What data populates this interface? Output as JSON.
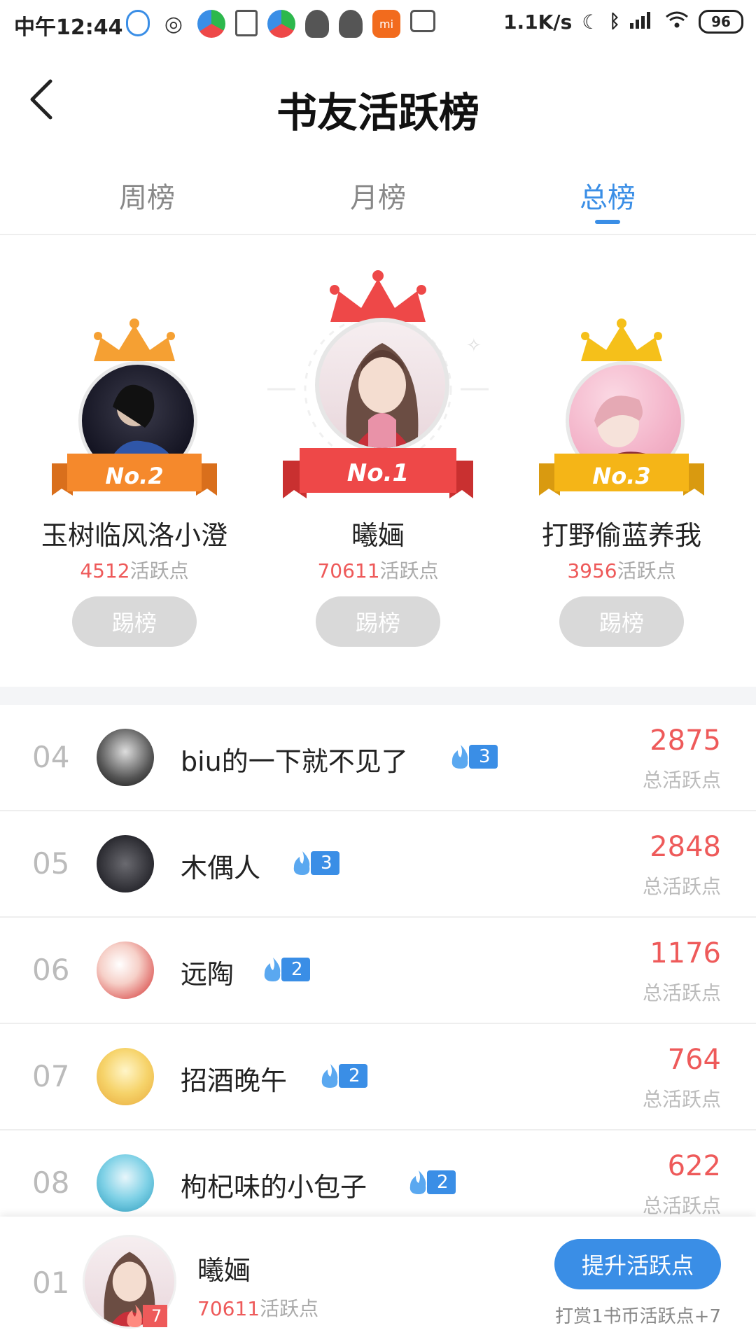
{
  "status_bar": {
    "time": "中午12:44",
    "network_speed": "1.1K/s",
    "battery": "96",
    "app_icons": [
      "qq-icon",
      "weibo-icon",
      "browser-icon",
      "doc-icon",
      "browser-icon",
      "qq-icon",
      "qq-icon",
      "mi-icon",
      "tv-icon"
    ]
  },
  "header": {
    "title": "书友活跃榜"
  },
  "tabs": [
    {
      "label": "周榜",
      "active": false
    },
    {
      "label": "月榜",
      "active": false
    },
    {
      "label": "总榜",
      "active": true
    }
  ],
  "podium": [
    {
      "rank_label": "No.2",
      "name": "玉树临风洛小澄",
      "score": "4512",
      "unit": "活跃点",
      "button": "踢榜",
      "crown_color": "#f5a033",
      "ribbon_color": "#f5892c"
    },
    {
      "rank_label": "No.1",
      "name": "曦婳",
      "score": "70611",
      "unit": "活跃点",
      "button": "踢榜",
      "crown_color": "#ee4848",
      "ribbon_color": "#ee4848"
    },
    {
      "rank_label": "No.3",
      "name": "打野偷蓝养我",
      "score": "3956",
      "unit": "活跃点",
      "button": "踢榜",
      "crown_color": "#f5c01a",
      "ribbon_color": "#f5b517"
    }
  ],
  "list": [
    {
      "rank": "04",
      "name": "biu的一下就不见了",
      "level": "3",
      "score": "2875",
      "score_label": "总活跃点"
    },
    {
      "rank": "05",
      "name": "木偶人",
      "level": "3",
      "score": "2848",
      "score_label": "总活跃点"
    },
    {
      "rank": "06",
      "name": "远陶",
      "level": "2",
      "score": "1176",
      "score_label": "总活跃点"
    },
    {
      "rank": "07",
      "name": "招酒晚午",
      "level": "2",
      "score": "764",
      "score_label": "总活跃点"
    },
    {
      "rank": "08",
      "name": "枸杞味的小包子",
      "level": "2",
      "score": "622",
      "score_label": "总活跃点"
    }
  ],
  "my_rank": {
    "rank": "01",
    "name": "曦婳",
    "level": "7",
    "score": "70611",
    "unit": "活跃点",
    "button": "提升活跃点",
    "hint": "打赏1书币活跃点+7"
  },
  "colors": {
    "accent": "#3a8ee6",
    "score": "#ee5a5a"
  }
}
